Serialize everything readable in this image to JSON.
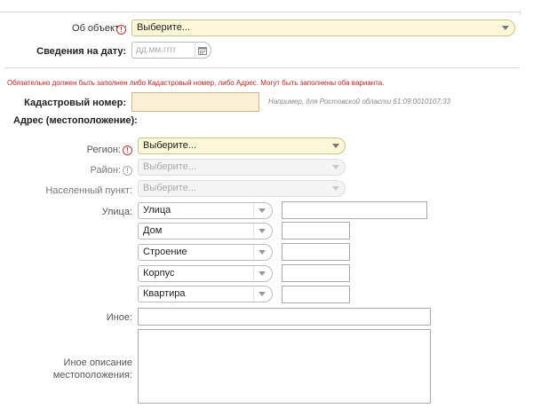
{
  "about_object": {
    "label": "Об объекте:",
    "select_value": "Выберите..."
  },
  "info_date": {
    "label": "Сведения на дату:",
    "placeholder": "дд.мм.гггг"
  },
  "warning_text": "Обязательно должен быть заполнен либо Кадастровый номер, либо Адрес. Могут быть заполнены оба варианта.",
  "cadastral": {
    "label": "Кадастровый номер:",
    "value": "",
    "hint": "Например, для Ростовской области 61:09:0010107:33"
  },
  "address_heading": "Адрес (местоположение):",
  "region": {
    "label": "Регион:",
    "value": "Выберите..."
  },
  "district": {
    "label": "Район:",
    "value": "Выберите..."
  },
  "locality": {
    "label": "Населенный пункт:",
    "value": "Выберите..."
  },
  "street": {
    "label": "Улица:",
    "type_value": "Улица",
    "value": ""
  },
  "house": {
    "type_value": "Дом",
    "value": ""
  },
  "building": {
    "type_value": "Строение",
    "value": ""
  },
  "block": {
    "type_value": "Корпус",
    "value": ""
  },
  "apartment": {
    "type_value": "Квартира",
    "value": ""
  },
  "other": {
    "label": "Иное:",
    "value": ""
  },
  "other_description": {
    "label_line1": "Иное описание",
    "label_line2": "местоположения:",
    "value": ""
  },
  "colors": {
    "required_mark": "#cc3333",
    "select_bg": "#fbf7d7",
    "cadastral_bg": "#fbf0d6",
    "warning": "#cc2222"
  },
  "icons": {
    "required": "required-icon",
    "calendar": "calendar-icon",
    "dropdown": "chevron-down-icon"
  }
}
